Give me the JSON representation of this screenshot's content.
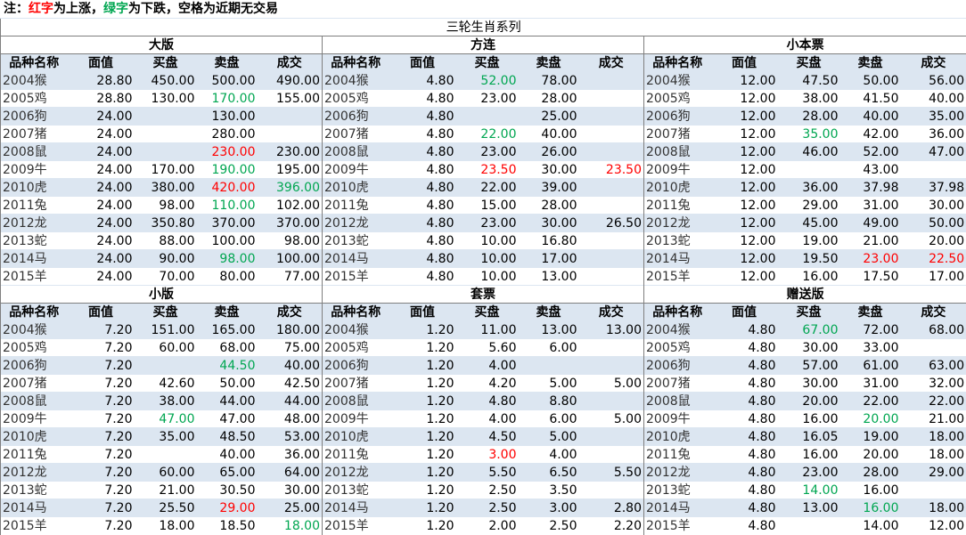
{
  "note": {
    "prefix": "注：",
    "red_word": "红字",
    "red_text": "为上涨，",
    "green_word": "绿字",
    "green_text": "为下跌，空格为近期无交易",
    "red_color": "#ff0000",
    "green_color": "#00a651"
  },
  "title": "三轮生肖系列",
  "columns": [
    "品种名称",
    "面值",
    "买盘",
    "卖盘",
    "成交"
  ],
  "panels": [
    {
      "name": "大版",
      "rows": [
        [
          "2004猴",
          "28.80",
          "450.00",
          "500.00",
          "490.00"
        ],
        [
          "2005鸡",
          "28.80",
          "130.00",
          "170.00",
          "155.00"
        ],
        [
          "2006狗",
          "24.00",
          "",
          "130.00",
          ""
        ],
        [
          "2007猪",
          "24.00",
          "",
          "280.00",
          ""
        ],
        [
          "2008鼠",
          "24.00",
          "",
          "230.00",
          "230.00"
        ],
        [
          "2009牛",
          "24.00",
          "170.00",
          "190.00",
          "195.00"
        ],
        [
          "2010虎",
          "24.00",
          "380.00",
          "420.00",
          "396.00"
        ],
        [
          "2011兔",
          "24.00",
          "98.00",
          "110.00",
          "102.00"
        ],
        [
          "2012龙",
          "24.00",
          "350.80",
          "370.00",
          "370.00"
        ],
        [
          "2013蛇",
          "24.00",
          "88.00",
          "100.00",
          "98.00"
        ],
        [
          "2014马",
          "24.00",
          "90.00",
          "98.00",
          "100.00"
        ],
        [
          "2015羊",
          "24.00",
          "70.00",
          "80.00",
          "77.00"
        ]
      ],
      "colors": [
        [
          "",
          "",
          "",
          "",
          ""
        ],
        [
          "",
          "",
          "",
          "g",
          ""
        ],
        [
          "",
          "",
          "",
          "",
          ""
        ],
        [
          "",
          "",
          "",
          "",
          ""
        ],
        [
          "",
          "",
          "",
          "r",
          ""
        ],
        [
          "",
          "",
          "",
          "g",
          ""
        ],
        [
          "",
          "",
          "",
          "r",
          "g"
        ],
        [
          "",
          "",
          "",
          "g",
          ""
        ],
        [
          "",
          "",
          "",
          "",
          ""
        ],
        [
          "",
          "",
          "",
          "",
          ""
        ],
        [
          "",
          "",
          "",
          "g",
          ""
        ],
        [
          "",
          "",
          "",
          "",
          ""
        ]
      ]
    },
    {
      "name": "方连",
      "rows": [
        [
          "2004猴",
          "4.80",
          "52.00",
          "78.00",
          ""
        ],
        [
          "2005鸡",
          "4.80",
          "23.00",
          "28.00",
          ""
        ],
        [
          "2006狗",
          "4.80",
          "",
          "25.00",
          ""
        ],
        [
          "2007猪",
          "4.80",
          "22.00",
          "40.00",
          ""
        ],
        [
          "2008鼠",
          "4.80",
          "23.00",
          "26.00",
          ""
        ],
        [
          "2009牛",
          "4.80",
          "23.50",
          "30.00",
          "23.50"
        ],
        [
          "2010虎",
          "4.80",
          "22.00",
          "39.00",
          ""
        ],
        [
          "2011兔",
          "4.80",
          "15.00",
          "28.00",
          ""
        ],
        [
          "2012龙",
          "4.80",
          "23.00",
          "30.00",
          "26.50"
        ],
        [
          "2013蛇",
          "4.80",
          "10.00",
          "16.80",
          ""
        ],
        [
          "2014马",
          "4.80",
          "10.00",
          "17.00",
          ""
        ],
        [
          "2015羊",
          "4.80",
          "10.00",
          "13.00",
          ""
        ]
      ],
      "colors": [
        [
          "",
          "",
          "g",
          "",
          ""
        ],
        [
          "",
          "",
          "",
          "",
          ""
        ],
        [
          "",
          "",
          "",
          "",
          ""
        ],
        [
          "",
          "",
          "g",
          "",
          ""
        ],
        [
          "",
          "",
          "",
          "",
          ""
        ],
        [
          "",
          "",
          "r",
          "",
          "r"
        ],
        [
          "",
          "",
          "",
          "",
          ""
        ],
        [
          "",
          "",
          "",
          "",
          ""
        ],
        [
          "",
          "",
          "",
          "",
          ""
        ],
        [
          "",
          "",
          "",
          "",
          ""
        ],
        [
          "",
          "",
          "",
          "",
          ""
        ],
        [
          "",
          "",
          "",
          "",
          ""
        ]
      ]
    },
    {
      "name": "小本票",
      "rows": [
        [
          "2004猴",
          "12.00",
          "47.50",
          "50.00",
          "56.00"
        ],
        [
          "2005鸡",
          "12.00",
          "38.00",
          "41.50",
          "40.00"
        ],
        [
          "2006狗",
          "12.00",
          "28.00",
          "40.00",
          "35.00"
        ],
        [
          "2007猪",
          "12.00",
          "35.00",
          "42.00",
          "36.00"
        ],
        [
          "2008鼠",
          "12.00",
          "46.00",
          "52.00",
          "47.00"
        ],
        [
          "2009牛",
          "12.00",
          "",
          "43.00",
          ""
        ],
        [
          "2010虎",
          "12.00",
          "36.00",
          "37.98",
          "37.98"
        ],
        [
          "2011兔",
          "12.00",
          "29.00",
          "31.00",
          "30.00"
        ],
        [
          "2012龙",
          "12.00",
          "45.00",
          "49.00",
          "50.00"
        ],
        [
          "2013蛇",
          "12.00",
          "19.00",
          "21.00",
          "20.00"
        ],
        [
          "2014马",
          "12.00",
          "19.50",
          "23.00",
          "22.50"
        ],
        [
          "2015羊",
          "12.00",
          "16.00",
          "17.50",
          "17.00"
        ]
      ],
      "colors": [
        [
          "",
          "",
          "",
          "",
          ""
        ],
        [
          "",
          "",
          "",
          "",
          ""
        ],
        [
          "",
          "",
          "",
          "",
          ""
        ],
        [
          "",
          "",
          "g",
          "",
          ""
        ],
        [
          "",
          "",
          "",
          "",
          ""
        ],
        [
          "",
          "",
          "",
          "",
          ""
        ],
        [
          "",
          "",
          "",
          "",
          ""
        ],
        [
          "",
          "",
          "",
          "",
          ""
        ],
        [
          "",
          "",
          "",
          "",
          ""
        ],
        [
          "",
          "",
          "",
          "",
          ""
        ],
        [
          "",
          "",
          "",
          "r",
          "r"
        ],
        [
          "",
          "",
          "",
          "",
          ""
        ]
      ]
    },
    {
      "name": "小版",
      "rows": [
        [
          "2004猴",
          "7.20",
          "151.00",
          "165.00",
          "180.00"
        ],
        [
          "2005鸡",
          "7.20",
          "60.00",
          "68.00",
          "75.00"
        ],
        [
          "2006狗",
          "7.20",
          "",
          "44.50",
          "40.00"
        ],
        [
          "2007猪",
          "7.20",
          "42.60",
          "50.00",
          "42.50"
        ],
        [
          "2008鼠",
          "7.20",
          "38.00",
          "44.00",
          "44.00"
        ],
        [
          "2009牛",
          "7.20",
          "47.00",
          "47.00",
          "48.00"
        ],
        [
          "2010虎",
          "7.20",
          "35.00",
          "48.50",
          "53.00"
        ],
        [
          "2011兔",
          "7.20",
          "",
          "40.00",
          "36.00"
        ],
        [
          "2012龙",
          "7.20",
          "60.00",
          "65.00",
          "64.00"
        ],
        [
          "2013蛇",
          "7.20",
          "21.00",
          "30.50",
          "30.00"
        ],
        [
          "2014马",
          "7.20",
          "25.50",
          "29.00",
          "25.00"
        ],
        [
          "2015羊",
          "7.20",
          "18.00",
          "18.50",
          "18.00"
        ]
      ],
      "colors": [
        [
          "",
          "",
          "",
          "",
          ""
        ],
        [
          "",
          "",
          "",
          "",
          ""
        ],
        [
          "",
          "",
          "",
          "g",
          ""
        ],
        [
          "",
          "",
          "",
          "",
          ""
        ],
        [
          "",
          "",
          "",
          "",
          ""
        ],
        [
          "",
          "",
          "g",
          "",
          ""
        ],
        [
          "",
          "",
          "",
          "",
          ""
        ],
        [
          "",
          "",
          "",
          "",
          ""
        ],
        [
          "",
          "",
          "",
          "",
          ""
        ],
        [
          "",
          "",
          "",
          "",
          ""
        ],
        [
          "",
          "",
          "",
          "r",
          ""
        ],
        [
          "",
          "",
          "",
          "",
          "g"
        ]
      ]
    },
    {
      "name": "套票",
      "rows": [
        [
          "2004猴",
          "1.20",
          "11.00",
          "13.00",
          "13.00"
        ],
        [
          "2005鸡",
          "1.20",
          "5.60",
          "6.00",
          ""
        ],
        [
          "2006狗",
          "1.20",
          "4.00",
          "",
          ""
        ],
        [
          "2007猪",
          "1.20",
          "4.20",
          "5.00",
          "5.00"
        ],
        [
          "2008鼠",
          "1.20",
          "4.80",
          "8.80",
          ""
        ],
        [
          "2009牛",
          "1.20",
          "4.00",
          "6.00",
          "5.00"
        ],
        [
          "2010虎",
          "1.20",
          "4.50",
          "5.00",
          ""
        ],
        [
          "2011兔",
          "1.20",
          "3.00",
          "4.00",
          ""
        ],
        [
          "2012龙",
          "1.20",
          "5.50",
          "6.50",
          "5.50"
        ],
        [
          "2013蛇",
          "1.20",
          "2.50",
          "3.50",
          ""
        ],
        [
          "2014马",
          "1.20",
          "2.50",
          "3.00",
          "2.80"
        ],
        [
          "2015羊",
          "1.20",
          "2.00",
          "2.50",
          "2.20"
        ]
      ],
      "colors": [
        [
          "",
          "",
          "",
          "",
          ""
        ],
        [
          "",
          "",
          "",
          "",
          ""
        ],
        [
          "",
          "",
          "",
          "",
          ""
        ],
        [
          "",
          "",
          "",
          "",
          ""
        ],
        [
          "",
          "",
          "",
          "",
          ""
        ],
        [
          "",
          "",
          "",
          "",
          ""
        ],
        [
          "",
          "",
          "",
          "",
          ""
        ],
        [
          "",
          "",
          "r",
          "",
          ""
        ],
        [
          "",
          "",
          "",
          "",
          ""
        ],
        [
          "",
          "",
          "",
          "",
          ""
        ],
        [
          "",
          "",
          "",
          "",
          ""
        ],
        [
          "",
          "",
          "",
          "",
          ""
        ]
      ]
    },
    {
      "name": "赠送版",
      "rows": [
        [
          "2004猴",
          "4.80",
          "67.00",
          "72.00",
          "68.00"
        ],
        [
          "2005鸡",
          "4.80",
          "30.00",
          "33.00",
          ""
        ],
        [
          "2006狗",
          "4.80",
          "57.00",
          "61.00",
          "63.00"
        ],
        [
          "2007猪",
          "4.80",
          "30.00",
          "31.00",
          "32.00"
        ],
        [
          "2008鼠",
          "4.80",
          "20.00",
          "22.00",
          "22.00"
        ],
        [
          "2009牛",
          "4.80",
          "16.00",
          "20.00",
          "21.00"
        ],
        [
          "2010虎",
          "4.80",
          "16.05",
          "19.00",
          "18.00"
        ],
        [
          "2011兔",
          "4.80",
          "16.00",
          "20.00",
          "18.00"
        ],
        [
          "2012龙",
          "4.80",
          "23.00",
          "28.00",
          "29.00"
        ],
        [
          "2013蛇",
          "4.80",
          "14.00",
          "16.00",
          ""
        ],
        [
          "2014马",
          "4.80",
          "13.00",
          "16.00",
          "18.00"
        ],
        [
          "2015羊",
          "4.80",
          "",
          "14.00",
          "12.00"
        ]
      ],
      "colors": [
        [
          "",
          "",
          "g",
          "",
          ""
        ],
        [
          "",
          "",
          "",
          "",
          ""
        ],
        [
          "",
          "",
          "",
          "",
          ""
        ],
        [
          "",
          "",
          "",
          "",
          ""
        ],
        [
          "",
          "",
          "",
          "",
          ""
        ],
        [
          "",
          "",
          "",
          "g",
          ""
        ],
        [
          "",
          "",
          "",
          "",
          ""
        ],
        [
          "",
          "",
          "",
          "",
          ""
        ],
        [
          "",
          "",
          "",
          "",
          ""
        ],
        [
          "",
          "",
          "g",
          "",
          ""
        ],
        [
          "",
          "",
          "",
          "g",
          ""
        ],
        [
          "",
          "",
          "",
          "",
          ""
        ]
      ]
    }
  ]
}
